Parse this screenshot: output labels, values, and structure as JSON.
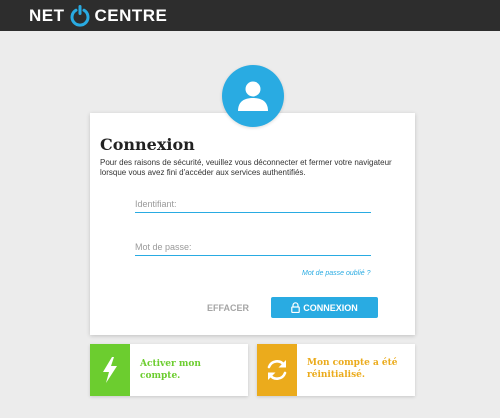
{
  "header": {
    "brand_left": "NET",
    "brand_right": "CENTRE",
    "brand_mark_icon": "power-ring-icon"
  },
  "login": {
    "avatar_icon": "user-icon",
    "title": "Connexion",
    "notice": "Pour des raisons de sécurité, veuillez vous déconnecter et fermer votre navigateur lorsque vous avez fini d'accéder aux services authentifiés.",
    "identifier": {
      "placeholder": "Identifiant:",
      "value": ""
    },
    "password": {
      "placeholder": "Mot de passe:",
      "value": ""
    },
    "forgot_link": "Mot de passe oublié ?",
    "clear_button": "EFFACER",
    "connect_button": "CONNEXION",
    "connect_icon": "lock-icon"
  },
  "tiles": {
    "activate": {
      "label": "Activer mon compte.",
      "icon": "lightning-icon",
      "color": "#6ccd2f"
    },
    "reset": {
      "label": "Mon compte a été réinitialisé.",
      "icon": "refresh-icon",
      "color": "#ebab1c"
    }
  },
  "colors": {
    "accent": "#29abe2",
    "header_bg": "#2d2d2d",
    "page_bg": "#ececec"
  }
}
